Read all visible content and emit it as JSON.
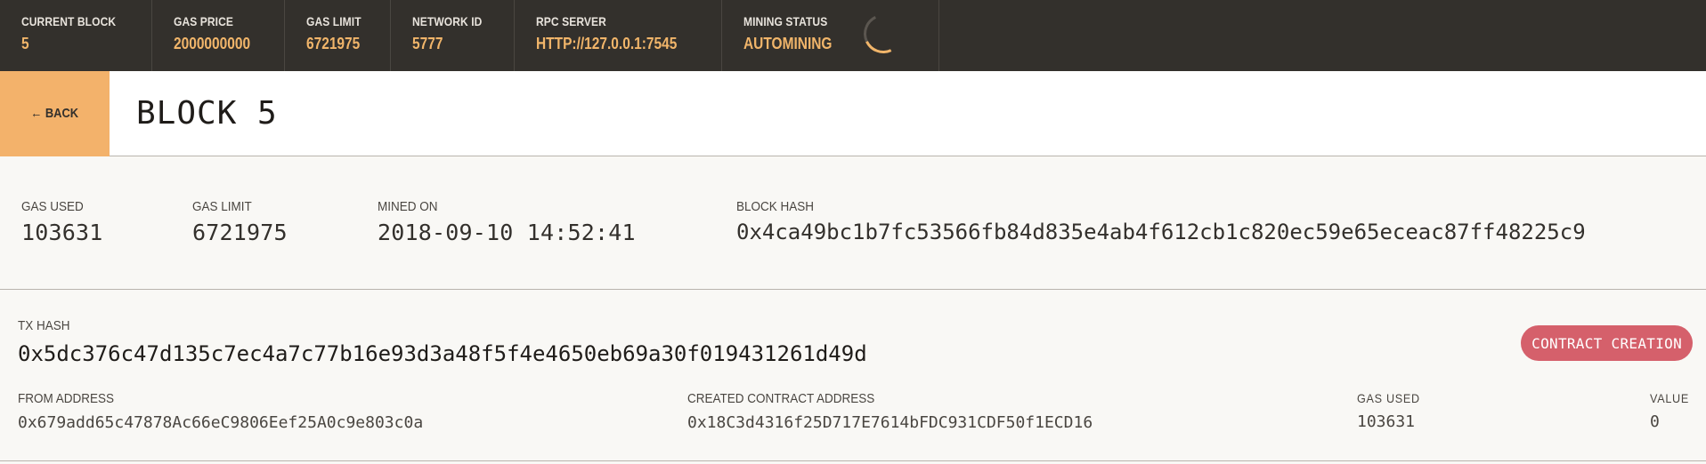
{
  "topbar": {
    "current_block": {
      "label": "CURRENT BLOCK",
      "value": "5"
    },
    "gas_price": {
      "label": "GAS PRICE",
      "value": "2000000000"
    },
    "gas_limit": {
      "label": "GAS LIMIT",
      "value": "6721975"
    },
    "network_id": {
      "label": "NETWORK ID",
      "value": "5777"
    },
    "rpc_server": {
      "label": "RPC SERVER",
      "value": "HTTP://127.0.0.1:7545"
    },
    "mining_status": {
      "label": "MINING STATUS",
      "value": "AUTOMINING"
    }
  },
  "header": {
    "back_label": "← BACK",
    "title": "BLOCK 5"
  },
  "block": {
    "gas_used": {
      "label": "GAS USED",
      "value": "103631"
    },
    "gas_limit": {
      "label": "GAS LIMIT",
      "value": "6721975"
    },
    "mined_on": {
      "label": "MINED ON",
      "value": "2018-09-10 14:52:41"
    },
    "block_hash": {
      "label": "BLOCK HASH",
      "value": "0x4ca49bc1b7fc53566fb84d835e4ab4f612cb1c820ec59e65eceac87ff48225c9"
    }
  },
  "transaction": {
    "hash_label": "TX HASH",
    "hash": "0x5dc376c47d135c7ec4a7c77b16e93d3a48f5f4e4650eb69a30f019431261d49d",
    "type_badge": "CONTRACT CREATION",
    "from": {
      "label": "FROM ADDRESS",
      "value": "0x679add65c47878Ac66eC9806Eef25A0c9e803c0a"
    },
    "created_contract": {
      "label": "CREATED CONTRACT ADDRESS",
      "value": "0x18C3d4316f25D717E7614bFDC931CDF50f1ECD16"
    },
    "gas_used": {
      "label": "GAS USED",
      "value": "103631"
    },
    "value": {
      "label": "VALUE",
      "value": "0"
    }
  },
  "colors": {
    "topbar_bg": "#33302c",
    "accent": "#f1b56a",
    "badge": "#d5606b"
  },
  "icons": {
    "mining_spinner": "spinner-icon"
  }
}
